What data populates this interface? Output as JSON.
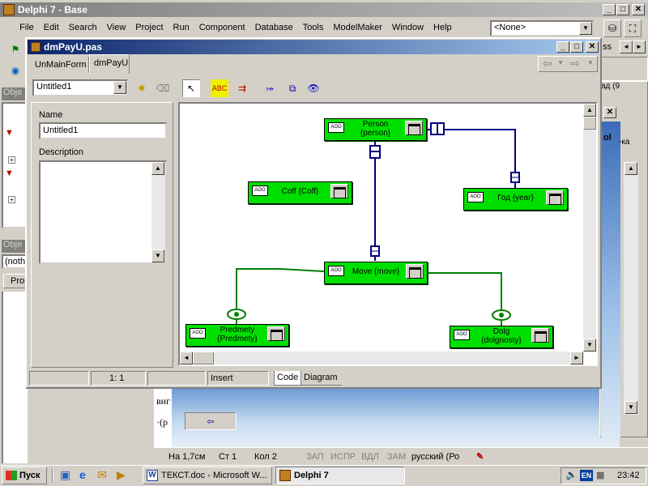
{
  "main_window": {
    "title": "Delphi 7 - Base",
    "menu": [
      "File",
      "Edit",
      "Search",
      "View",
      "Project",
      "Run",
      "Component",
      "Database",
      "Tools",
      "ModelMaker",
      "Window",
      "Help"
    ],
    "combo_value": "<None>",
    "sidebar_title_1": "Obje",
    "sidebar_title_2": "Obje",
    "sidebar_combo": "(noth",
    "sidebar_tab": "Prop"
  },
  "editor_window": {
    "title": "dmPayU.pas",
    "tabs": [
      "UnMainForm",
      "dmPayU"
    ],
    "diagram_combo": "Untitled1",
    "name_label": "Name",
    "name_value": "Untitled1",
    "description_label": "Description",
    "status": {
      "position": "1:  1",
      "mode": "Insert"
    },
    "bottom_tabs": [
      "Code",
      "Diagram"
    ]
  },
  "diagram": {
    "entities": [
      {
        "id": "person",
        "line1": "Person",
        "line2": "{person}"
      },
      {
        "id": "coff",
        "line1": "Coff {Coff}",
        "line2": ""
      },
      {
        "id": "god",
        "line1": "Год {year}",
        "line2": ""
      },
      {
        "id": "move",
        "line1": "Move {move}",
        "line2": ""
      },
      {
        "id": "predmety",
        "line1": "Predmety",
        "line2": "{Predmety}"
      },
      {
        "id": "dolg",
        "line1": "Dolg",
        "line2": "{dolgnosty}"
      }
    ],
    "icon_text": "AOO"
  },
  "background_doc": {
    "snippet_1": "виг",
    "snippet_2": "·(р",
    "snippet_3": "ol",
    "snippet_4": "-ка",
    "snippet_5": "ss",
    "snippet_6": "ад (9"
  },
  "word_status": {
    "page": "На 1,7см",
    "line": "Ст 1",
    "col": "Кол 2",
    "rec": "ЗАП",
    "trk": "ИСПР",
    "ext": "ВДЛ",
    "ovr": "ЗАМ",
    "lang": "русский (Ро"
  },
  "taskbar": {
    "start": "Пуск",
    "tasks": [
      "ТЕКСТ.doc - Microsoft W...",
      "Delphi 7"
    ],
    "lang": "EN",
    "clock": "23:42"
  },
  "colors": {
    "entity_fill": "#00e000",
    "line_blue": "#000080",
    "line_green": "#008000",
    "title_active": "#0a246a"
  }
}
